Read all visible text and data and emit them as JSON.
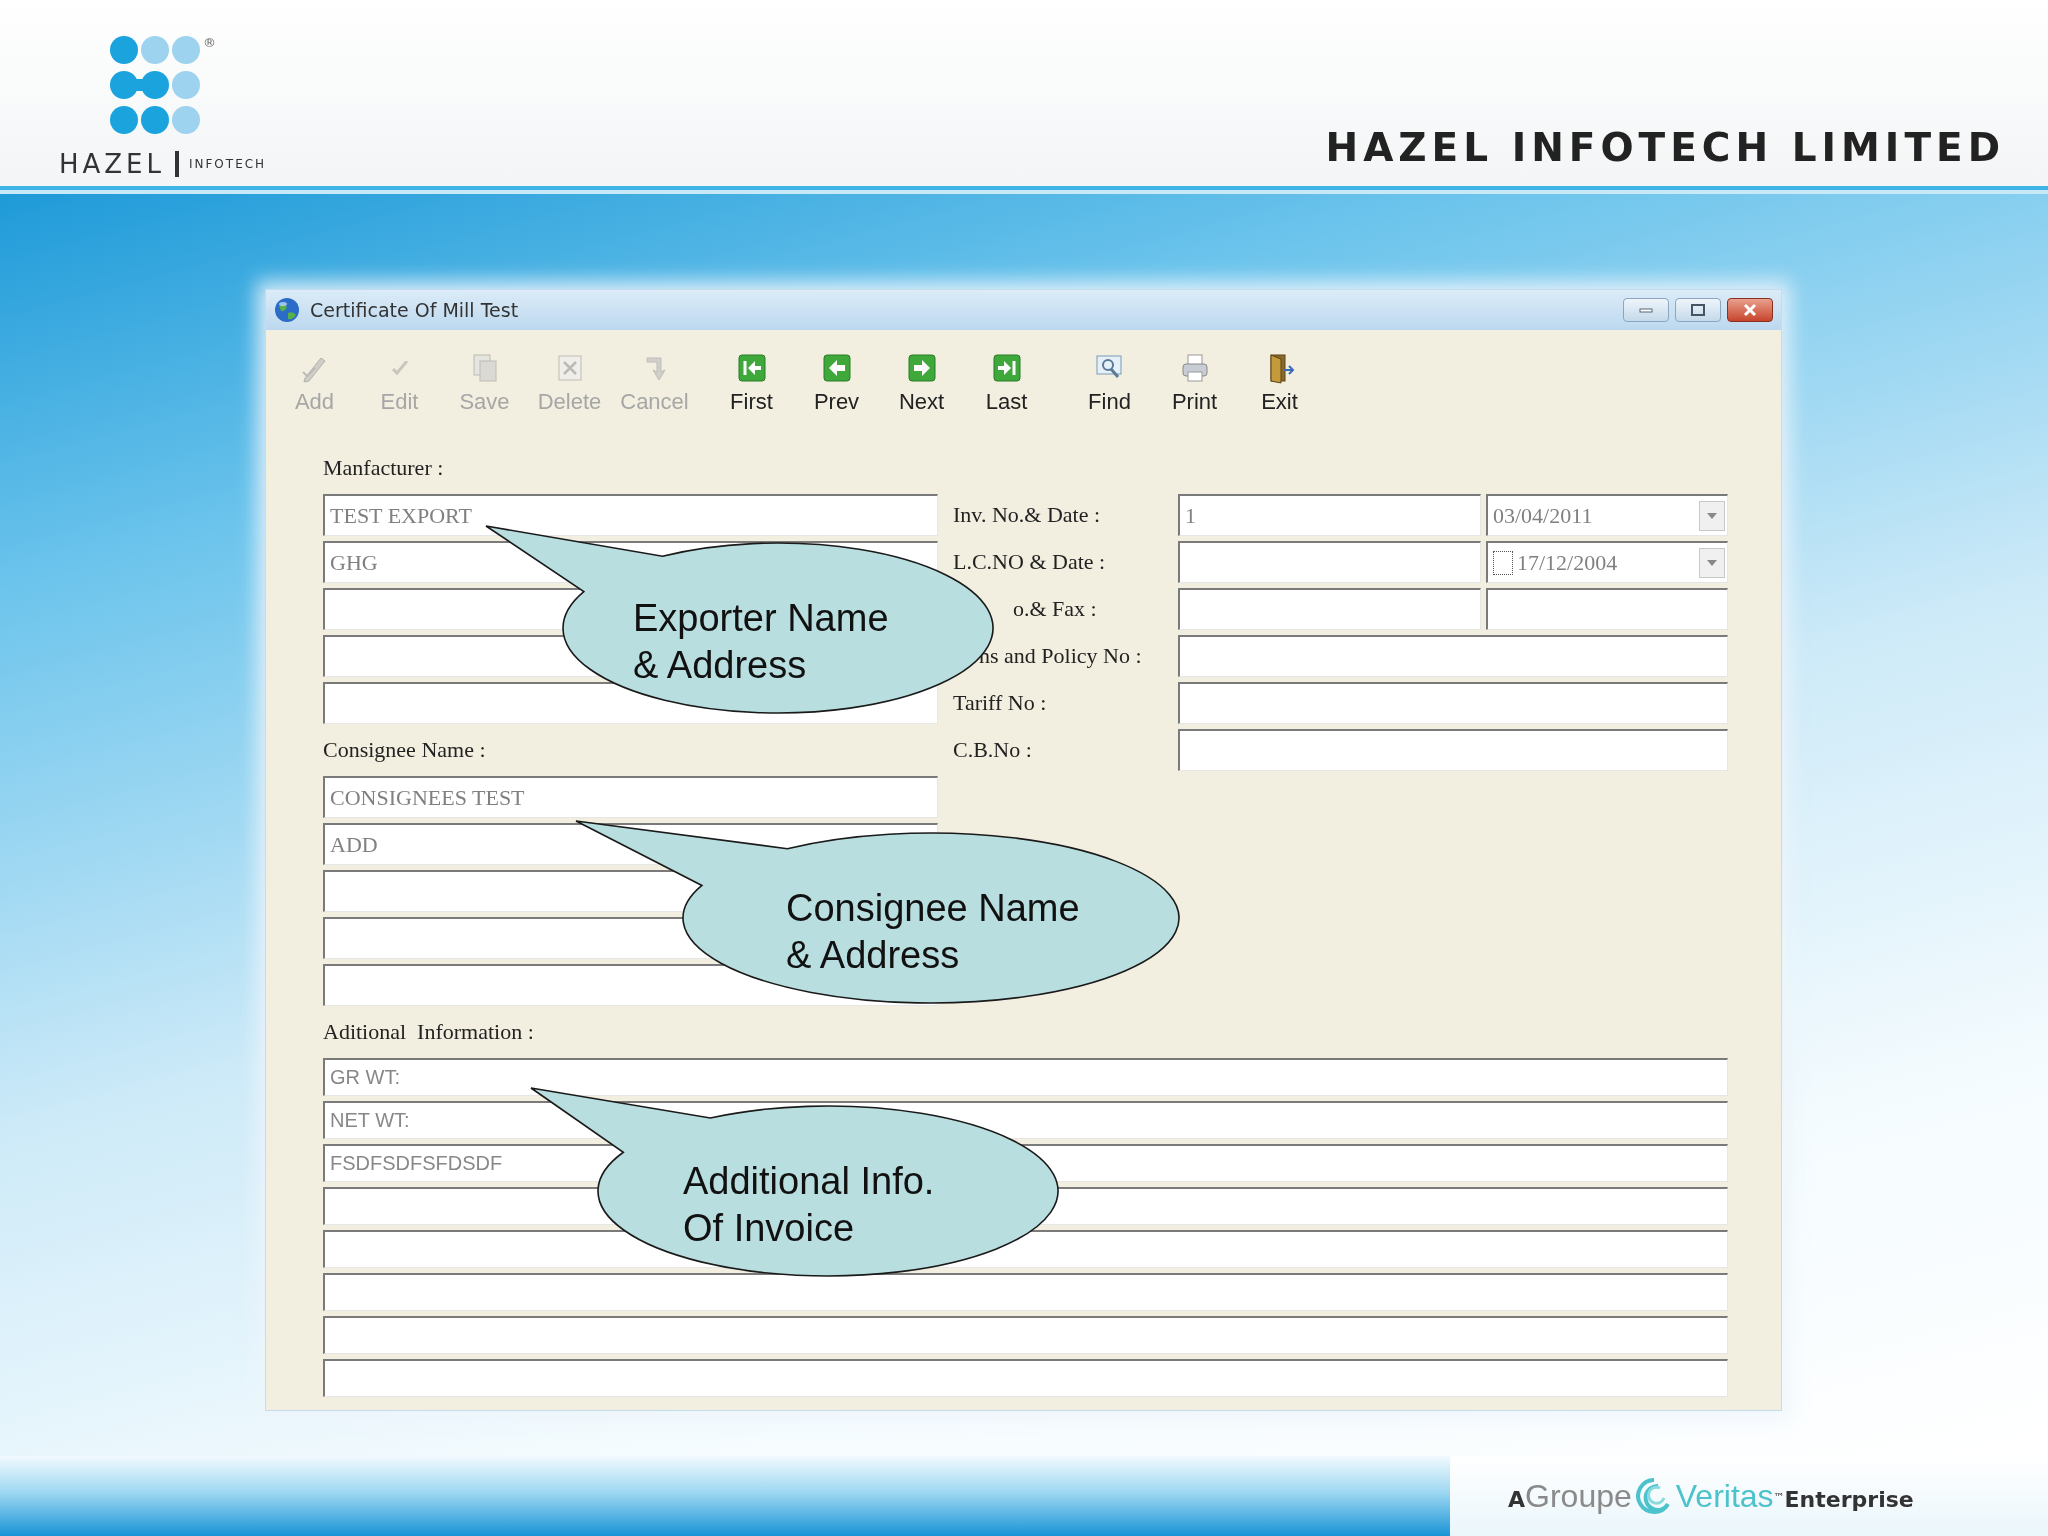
{
  "header": {
    "logo": {
      "name": "HAZEL",
      "sub": "INFOTECH",
      "registered": "®"
    },
    "company": "HAZEL INFOTECH LIMITED"
  },
  "window": {
    "title": "Certificate Of Mill Test"
  },
  "toolbar": [
    {
      "kind": "add",
      "label": "Add",
      "disabled": true
    },
    {
      "kind": "edit",
      "label": "Edit",
      "disabled": true
    },
    {
      "kind": "save",
      "label": "Save",
      "disabled": true
    },
    {
      "kind": "delete",
      "label": "Delete",
      "disabled": true
    },
    {
      "kind": "cancel",
      "label": "Cancel",
      "disabled": true
    },
    {
      "kind": "first",
      "label": "First",
      "disabled": false
    },
    {
      "kind": "prev",
      "label": "Prev",
      "disabled": false
    },
    {
      "kind": "next",
      "label": "Next",
      "disabled": false
    },
    {
      "kind": "last",
      "label": "Last",
      "disabled": false
    },
    {
      "kind": "find",
      "label": "Find",
      "disabled": false
    },
    {
      "kind": "print",
      "label": "Print",
      "disabled": false
    },
    {
      "kind": "exit",
      "label": "Exit",
      "disabled": false
    }
  ],
  "form": {
    "manufacturer": {
      "label": "Manfacturer :",
      "lines": [
        {
          "kind": "text",
          "value": "TEST EXPORT"
        },
        {
          "kind": "text",
          "value": "GHG"
        },
        {
          "kind": "text"
        },
        {
          "kind": "text"
        },
        {
          "kind": "text"
        }
      ]
    },
    "consignee": {
      "label": "Consignee Name :",
      "lines": [
        {
          "kind": "text",
          "value": "CONSIGNEES TEST"
        },
        {
          "kind": "text",
          "value": "ADD"
        },
        {
          "kind": "text"
        },
        {
          "kind": "text"
        },
        {
          "kind": "text"
        }
      ]
    },
    "details": [
      {
        "label": "Inv. No.& Date :",
        "fields": [
          {
            "kind": "text",
            "value": "1"
          },
          {
            "kind": "date",
            "value": "03/04/2011"
          }
        ]
      },
      {
        "label": "L.C.NO & Date :",
        "fields": [
          {
            "kind": "text"
          },
          {
            "kind": "date_check",
            "value": "17/12/2004",
            "checked": false
          }
        ]
      },
      {
        "label": "o.& Fax :",
        "fields": [
          {
            "kind": "text"
          },
          {
            "kind": "text"
          }
        ]
      },
      {
        "label": "ns and Policy No :",
        "fields": [
          {
            "kind": "wide"
          }
        ]
      },
      {
        "label": "Tariff No :",
        "fields": [
          {
            "kind": "wide"
          }
        ]
      },
      {
        "label": "C.B.No :",
        "fields": [
          {
            "kind": "wide"
          }
        ]
      }
    ],
    "additional": {
      "label": "Aditional  Information :",
      "lines": [
        {
          "kind": "text",
          "value": "GR WT:"
        },
        {
          "kind": "text",
          "value": "NET WT:"
        },
        {
          "kind": "text",
          "value": "FSDFSDFSFDSDF"
        },
        {
          "kind": "text"
        },
        {
          "kind": "text"
        },
        {
          "kind": "text"
        },
        {
          "kind": "text"
        },
        {
          "kind": "text"
        }
      ]
    }
  },
  "callouts": [
    {
      "lines": [
        "Exporter Name",
        "& Address"
      ]
    },
    {
      "lines": [
        "Consignee Name",
        "& Address"
      ]
    },
    {
      "lines": [
        "Additional Info.",
        "Of Invoice"
      ]
    }
  ],
  "footer": {
    "prefix": "A",
    "group": "Groupe",
    "brand": "Veritas",
    "tm": "™",
    "suffix": "Enterprise"
  }
}
